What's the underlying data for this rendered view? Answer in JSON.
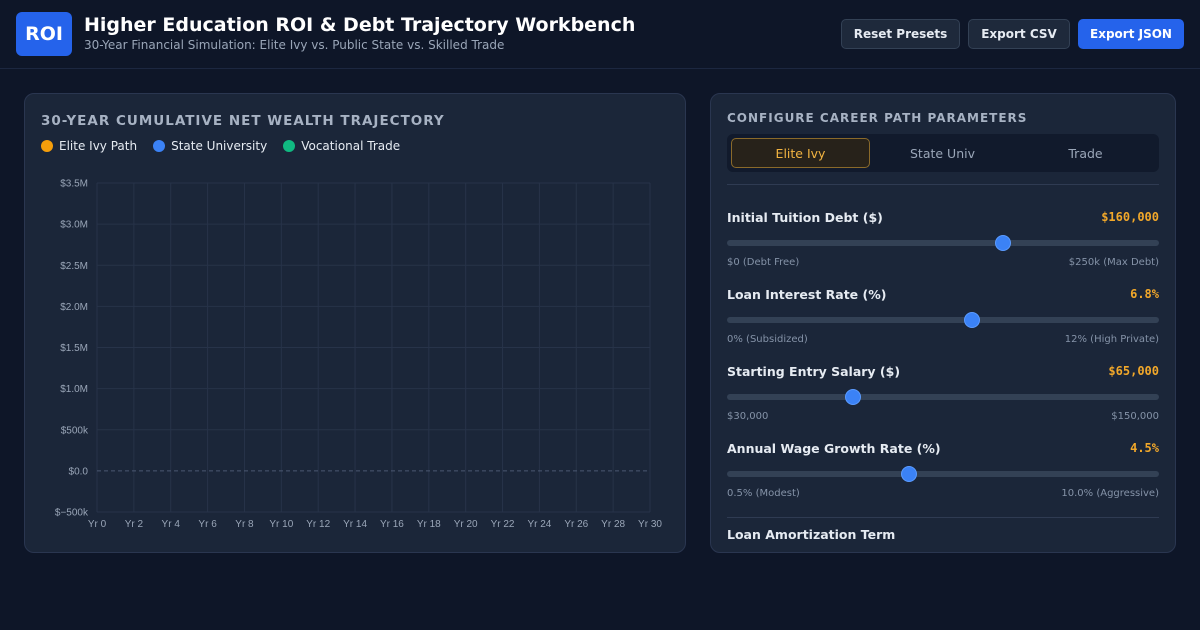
{
  "header": {
    "logo": "ROI",
    "title": "Higher Education ROI & Debt Trajectory Workbench",
    "subtitle": "30-Year Financial Simulation: Elite Ivy vs. Public State vs. Skilled Trade",
    "buttons": {
      "reset": "Reset Presets",
      "export_csv": "Export CSV",
      "export_json": "Export JSON"
    }
  },
  "chart_panel": {
    "title": "30-YEAR CUMULATIVE NET WEALTH TRAJECTORY",
    "legend": [
      {
        "label": "Elite Ivy Path",
        "color": "#f59e0b"
      },
      {
        "label": "State University",
        "color": "#3b82f6"
      },
      {
        "label": "Vocational Trade",
        "color": "#10b981"
      }
    ]
  },
  "chart_data": {
    "type": "line",
    "x_ticks": [
      "Yr 0",
      "Yr 2",
      "Yr 4",
      "Yr 6",
      "Yr 8",
      "Yr 10",
      "Yr 12",
      "Yr 14",
      "Yr 16",
      "Yr 18",
      "Yr 20",
      "Yr 22",
      "Yr 24",
      "Yr 26",
      "Yr 28",
      "Yr 30"
    ],
    "y_ticks": [
      "$3.5M",
      "$3.0M",
      "$2.5M",
      "$2.0M",
      "$1.5M",
      "$1.0M",
      "$500k",
      "$0.0",
      "$−500k"
    ],
    "xlim": [
      0,
      30
    ],
    "ylim": [
      -500000,
      3500000
    ],
    "grid": true,
    "series": []
  },
  "config": {
    "title": "CONFIGURE CAREER PATH PARAMETERS",
    "tabs": [
      {
        "label": "Elite Ivy",
        "active": true
      },
      {
        "label": "State Univ",
        "active": false
      },
      {
        "label": "Trade",
        "active": false
      }
    ],
    "params": [
      {
        "label": "Initial Tuition Debt ($)",
        "value": "$160,000",
        "min_label": "$0 (Debt Free)",
        "max_label": "$250k (Max Debt)",
        "fraction": 0.64
      },
      {
        "label": "Loan Interest Rate (%)",
        "value": "6.8%",
        "min_label": "0% (Subsidized)",
        "max_label": "12% (High Private)",
        "fraction": 0.567
      },
      {
        "label": "Starting Entry Salary ($)",
        "value": "$65,000",
        "min_label": "$30,000",
        "max_label": "$150,000",
        "fraction": 0.292
      },
      {
        "label": "Annual Wage Growth Rate (%)",
        "value": "4.5%",
        "min_label": "0.5% (Modest)",
        "max_label": "10.0% (Aggressive)",
        "fraction": 0.421
      }
    ],
    "amortization_label": "Loan Amortization Term"
  }
}
